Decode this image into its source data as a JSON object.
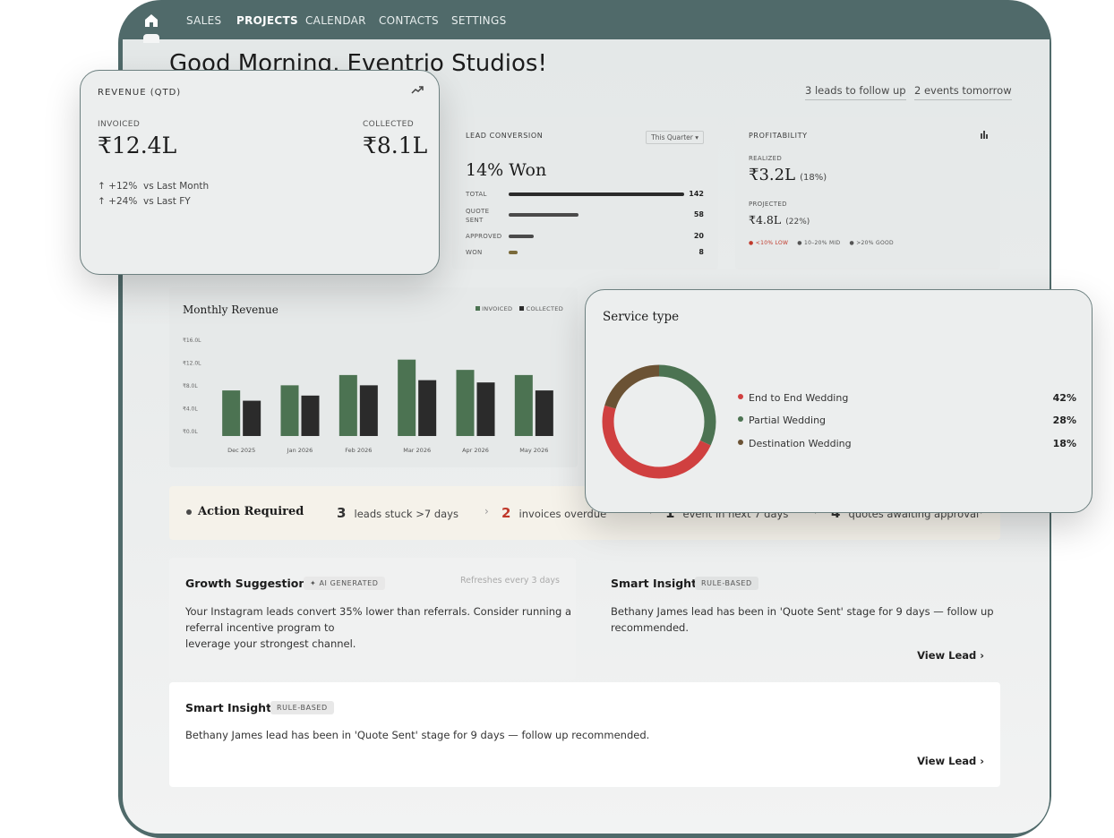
{
  "nav": {
    "items": [
      "SALES",
      "PROJECTS",
      "CALENDAR",
      "CONTACTS",
      "SETTINGS"
    ],
    "active": "PROJECTS"
  },
  "greeting": "Good Morning, Eventrio Studios!",
  "quick_links": [
    "3 leads to follow up",
    "2 events tomorrow"
  ],
  "revenue": {
    "title": "REVENUE (QTD)",
    "invoiced_label": "INVOICED",
    "invoiced_value": "₹12.4L",
    "collected_label": "COLLECTED",
    "collected_value": "₹8.1L",
    "deltas": [
      {
        "change": "+12%",
        "text": "vs Last Month"
      },
      {
        "change": "+24%",
        "text": "vs Last FY"
      }
    ]
  },
  "lead_conversion": {
    "title": "LEAD CONVERSION",
    "dropdown": "This Quarter",
    "won_text": "14% Won",
    "rows": [
      {
        "label": "TOTAL",
        "value": 142
      },
      {
        "label": "QUOTE SENT",
        "value": 58
      },
      {
        "label": "APPROVED",
        "value": 20
      },
      {
        "label": "WON",
        "value": 8
      }
    ]
  },
  "profitability": {
    "title": "PROFITABILITY",
    "realized_label": "REALIZED",
    "realized_value": "₹3.2L",
    "realized_pct": "(18%)",
    "projected_label": "PROJECTED",
    "projected_value": "₹4.8L",
    "projected_pct": "(22%)",
    "legend": [
      {
        "label": "<10% LOW",
        "color": "#c0392b"
      },
      {
        "label": "10–20% MID",
        "color": "#555555"
      },
      {
        "label": ">20% GOOD",
        "color": "#555555"
      }
    ]
  },
  "chart_data": {
    "type": "bar",
    "title": "Monthly Revenue",
    "categories": [
      "Dec 2025",
      "Jan 2026",
      "Feb 2026",
      "Mar 2026",
      "Apr 2026",
      "May 2026"
    ],
    "series": [
      {
        "name": "INVOICED",
        "color": "#4c7352",
        "values": [
          7.2,
          8.1,
          9.9,
          12.6,
          10.8,
          9.9
        ]
      },
      {
        "name": "COLLECTED",
        "color": "#2b2b2b",
        "values": [
          5.4,
          6.3,
          8.1,
          9.0,
          8.6,
          7.2
        ]
      }
    ],
    "yticks": [
      "₹16.0L",
      "₹12.0L",
      "₹8.0L",
      "₹4.0L",
      "₹0.0L"
    ],
    "ylim": [
      0,
      16
    ],
    "legend_position": "top-right"
  },
  "service_type": {
    "title": "Service type",
    "items": [
      {
        "label": "End to End Wedding",
        "pct": "42%",
        "value": 42,
        "color": "#d04040"
      },
      {
        "label": "Partial Wedding",
        "pct": "28%",
        "value": 28,
        "color": "#4c7352"
      },
      {
        "label": "Destination Wedding",
        "pct": "18%",
        "value": 18,
        "color": "#6b5234"
      }
    ]
  },
  "action_required": {
    "title": "Action Required",
    "items": [
      {
        "count": "3",
        "text": "leads stuck >7 days",
        "color": "#333333"
      },
      {
        "count": "2",
        "text": "invoices overdue",
        "color": "#c0392b"
      },
      {
        "count": "1",
        "text": "event in next 7 days",
        "color": "#333333"
      },
      {
        "count": "4",
        "text": "quotes awaiting approval",
        "color": "#333333"
      }
    ]
  },
  "growth": {
    "title": "Growth Suggestion",
    "badge": "AI GENERATED",
    "refresh": "Refreshes every 3 days",
    "line1": "Your Instagram leads convert 35% lower than referrals. Consider running a",
    "line2": "referral incentive program to",
    "line3": "leverage your strongest channel."
  },
  "smart_insight_1": {
    "title": "Smart Insight",
    "badge": "RULE-BASED",
    "line1": "Bethany James lead has been in 'Quote Sent' stage for 9 days — follow up",
    "line2": "recommended.",
    "link": "View Lead ›"
  },
  "smart_insight_2": {
    "title": "Smart Insight",
    "badge": "RULE-BASED",
    "text": "Bethany James lead has been in 'Quote Sent' stage for 9 days — follow up recommended.",
    "link": "View Lead ›"
  }
}
